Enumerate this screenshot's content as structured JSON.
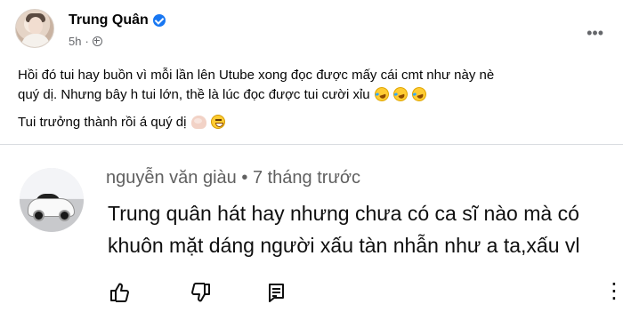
{
  "post": {
    "author": "Trung Quân",
    "time": "5h",
    "separator": "·",
    "menu_label": "•••",
    "text_lines": [
      "Hồi đó tui hay buồn vì mỗi lần lên Utube xong đọc được mấy cái cmt như này nè",
      "quý dị. Nhưng bây h tui lớn, thề là lúc đọc được tui cười xỉu",
      "Tui trưởng thành rồi á quý dị"
    ],
    "icons": [
      "verified-icon",
      "globe-icon",
      "more-menu-icon",
      "laughing-emoji",
      "flexed-biceps-emoji",
      "grinning-emoji"
    ]
  },
  "comment": {
    "user": "nguyễn văn giàu",
    "separator": "•",
    "time": "7 tháng trước",
    "text_lines": [
      "Trung quân hát hay nhưng chưa có ca sĩ nào mà có",
      "khuôn mặt dáng người xấu tàn nhẫn như a ta,xấu vl"
    ],
    "actions": [
      "like-icon",
      "dislike-icon",
      "reply-icon",
      "more-vertical-icon"
    ],
    "more_label": "⋮"
  },
  "colors": {
    "verified": "#1877f2",
    "secondary_text": "#65676b",
    "comment_meta": "#606060",
    "divider": "#dadde1"
  }
}
